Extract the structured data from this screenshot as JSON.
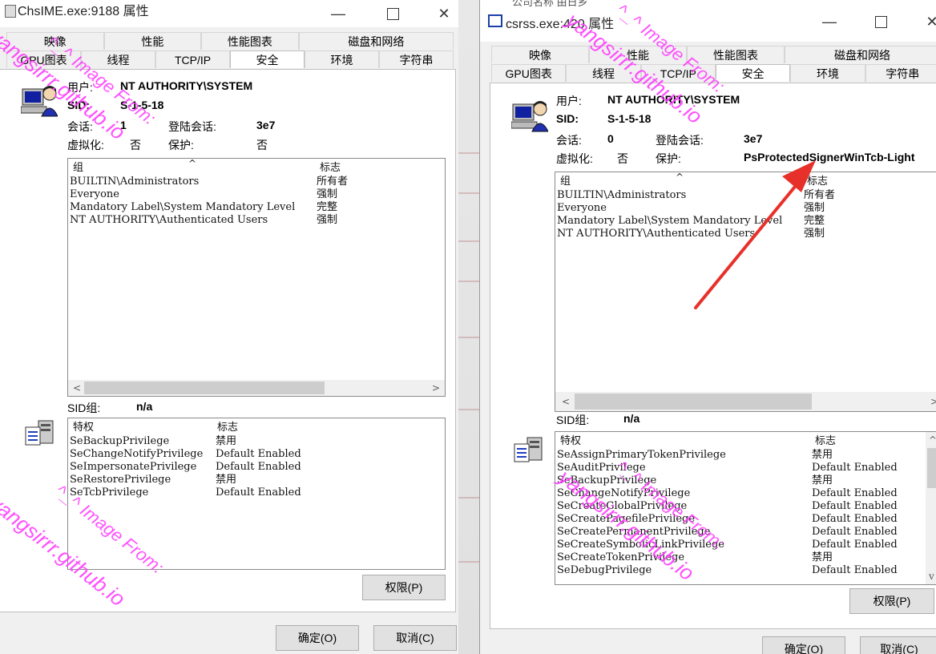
{
  "win1": {
    "title": "ChsIME.exe:9188 属性",
    "tabs_row1": [
      "映像",
      "性能",
      "性能图表",
      "磁盘和网络"
    ],
    "tabs_row2": [
      "GPU图表",
      "线程",
      "TCP/IP",
      "安全",
      "环境",
      "字符串"
    ],
    "user_label": "用户:",
    "user_value": "NT AUTHORITY\\SYSTEM",
    "sid_label": "SID:",
    "sid_value": "S-1-5-18",
    "session_label": "会话:",
    "session_value": "1",
    "logon_label": "登陆会话:",
    "logon_value": "3e7",
    "virt_label": "虚拟化:",
    "virt_value": "否",
    "protect_label": "保护:",
    "protect_value": "否",
    "groups_header": {
      "group": "组",
      "flags": "标志"
    },
    "groups": [
      {
        "name": "BUILTIN\\Administrators",
        "flag": "所有者"
      },
      {
        "name": "Everyone",
        "flag": "强制"
      },
      {
        "name": "Mandatory Label\\System Mandatory Level",
        "flag": "完整"
      },
      {
        "name": "NT AUTHORITY\\Authenticated Users",
        "flag": "强制"
      }
    ],
    "sid_group_label": "SID组:",
    "sid_group_value": "n/a",
    "priv_header": {
      "priv": "特权",
      "flags": "标志"
    },
    "privileges": [
      {
        "name": "SeBackupPrivilege",
        "flag": "禁用"
      },
      {
        "name": "SeChangeNotifyPrivilege",
        "flag": "Default Enabled"
      },
      {
        "name": "SeImpersonatePrivilege",
        "flag": "Default Enabled"
      },
      {
        "name": "SeRestorePrivilege",
        "flag": "禁用"
      },
      {
        "name": "SeTcbPrivilege",
        "flag": "Default Enabled"
      }
    ],
    "perm_button": "权限(P)",
    "ok_button": "确定(O)",
    "cancel_button": "取消(C)"
  },
  "win2": {
    "title": "csrss.exe:420 属性",
    "behind_text": "公司名称   由日乡",
    "tabs_row1": [
      "映像",
      "性能",
      "性能图表",
      "磁盘和网络"
    ],
    "tabs_row2": [
      "GPU图表",
      "线程",
      "TCP/IP",
      "安全",
      "环境",
      "字符串"
    ],
    "user_label": "用户:",
    "user_value": "NT AUTHORITY\\SYSTEM",
    "sid_label": "SID:",
    "sid_value": "S-1-5-18",
    "session_label": "会话:",
    "session_value": "0",
    "logon_label": "登陆会话:",
    "logon_value": "3e7",
    "virt_label": "虚拟化:",
    "virt_value": "否",
    "protect_label": "保护:",
    "protect_value": "PsProtectedSignerWinTcb-Light",
    "groups_header": {
      "group": "组",
      "flags": "标志"
    },
    "groups": [
      {
        "name": "BUILTIN\\Administrators",
        "flag": "所有者"
      },
      {
        "name": "Everyone",
        "flag": "强制"
      },
      {
        "name": "Mandatory Label\\System Mandatory Level",
        "flag": "完整"
      },
      {
        "name": "NT AUTHORITY\\Authenticated Users",
        "flag": "强制"
      }
    ],
    "sid_group_label": "SID组:",
    "sid_group_value": "n/a",
    "priv_header": {
      "priv": "特权",
      "flags": "标志"
    },
    "privileges": [
      {
        "name": "SeAssignPrimaryTokenPrivilege",
        "flag": "禁用"
      },
      {
        "name": "SeAuditPrivilege",
        "flag": "Default Enabled"
      },
      {
        "name": "SeBackupPrivilege",
        "flag": "禁用"
      },
      {
        "name": "SeChangeNotifyPrivilege",
        "flag": "Default Enabled"
      },
      {
        "name": "SeCreateGlobalPrivilege",
        "flag": "Default Enabled"
      },
      {
        "name": "SeCreatePagefilePrivilege",
        "flag": "Default Enabled"
      },
      {
        "name": "SeCreatePermanentPrivilege",
        "flag": "Default Enabled"
      },
      {
        "name": "SeCreateSymbolicLinkPrivilege",
        "flag": "Default Enabled"
      },
      {
        "name": "SeCreateTokenPrivilege",
        "flag": "禁用"
      },
      {
        "name": "SeDebugPrivilege",
        "flag": "Default Enabled"
      }
    ],
    "perm_button": "权限(P)",
    "ok_button": "确定(O)",
    "cancel_button": "取消(C)"
  },
  "watermark": {
    "line1": "^_^ Image From:",
    "line2": "yangsirrr.github.io"
  },
  "colors": {
    "watermark": "#ff40ff",
    "arrow": "#e8302a",
    "scroll_thumb": "#cdcdcd"
  }
}
